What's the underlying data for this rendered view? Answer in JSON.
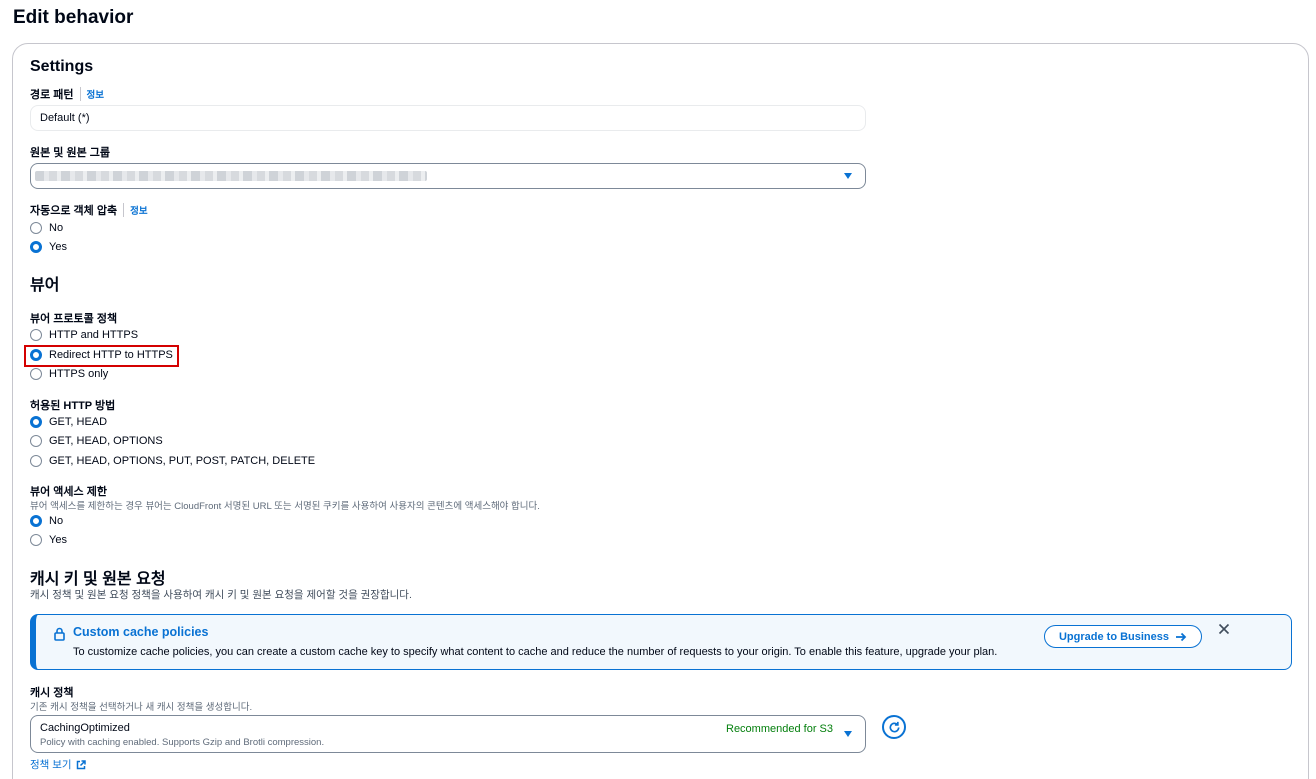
{
  "page": {
    "title": "Edit behavior"
  },
  "settings": {
    "heading": "Settings",
    "path_pattern": {
      "label": "경로 패턴",
      "info": "정보",
      "value": "Default (*)"
    },
    "origin": {
      "label": "원본 및 원본 그룹"
    },
    "compress": {
      "label": "자동으로 객체 압축",
      "info": "정보",
      "options": [
        {
          "label": "No",
          "selected": false
        },
        {
          "label": "Yes",
          "selected": true
        }
      ]
    }
  },
  "viewer": {
    "heading": "뷰어",
    "protocol_policy": {
      "label": "뷰어 프로토콜 정책",
      "options": [
        {
          "label": "HTTP and HTTPS",
          "selected": false
        },
        {
          "label": "Redirect HTTP to HTTPS",
          "selected": true
        },
        {
          "label": "HTTPS only",
          "selected": false
        }
      ]
    },
    "allowed_methods": {
      "label": "허용된 HTTP 방법",
      "options": [
        {
          "label": "GET, HEAD",
          "selected": true
        },
        {
          "label": "GET, HEAD, OPTIONS",
          "selected": false
        },
        {
          "label": "GET, HEAD, OPTIONS, PUT, POST, PATCH, DELETE",
          "selected": false
        }
      ]
    },
    "restrict_access": {
      "label": "뷰어 액세스 제한",
      "description": "뷰어 액세스를 제한하는 경우 뷰어는 CloudFront 서명된 URL 또는 서명된 쿠키를 사용하여 사용자의 콘텐츠에 액세스해야 합니다.",
      "options": [
        {
          "label": "No",
          "selected": true
        },
        {
          "label": "Yes",
          "selected": false
        }
      ]
    }
  },
  "cache": {
    "heading": "캐시 키 및 원본 요청",
    "description": "캐시 정책 및 원본 요청 정책을 사용하여 캐시 키 및 원본 요청을 제어할 것을 권장합니다.",
    "alert": {
      "title": "Custom cache policies",
      "body": "To customize cache policies, you can create a custom cache key to specify what content to cache and reduce the number of requests to your origin. To enable this feature, upgrade your plan.",
      "button": "Upgrade to Business"
    },
    "policy": {
      "label": "캐시 정책",
      "description": "기존 캐시 정책을 선택하거나 새 캐시 정책을 생성합니다.",
      "value": "CachingOptimized",
      "value_description": "Policy with caching enabled. Supports Gzip and Brotli compression.",
      "badge": "Recommended for S3",
      "link": "정책 보기"
    }
  },
  "colors": {
    "accent": "#0972d3",
    "success": "#037f0c",
    "highlight": "#d40000"
  }
}
